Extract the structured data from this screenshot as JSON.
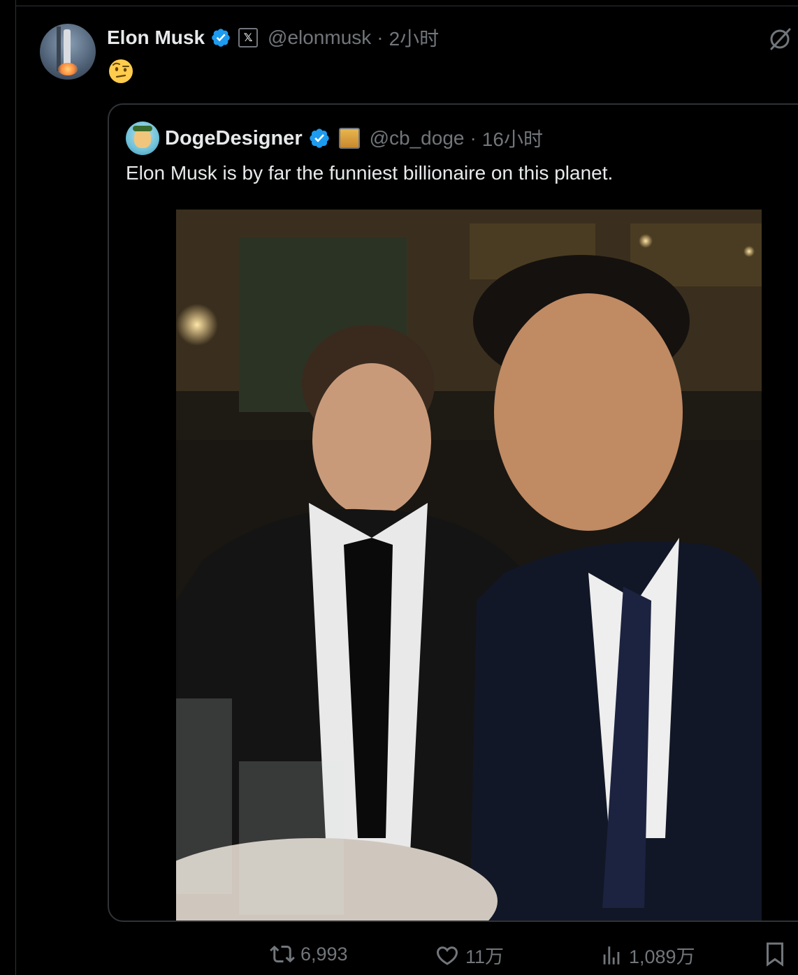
{
  "post": {
    "author": {
      "name": "Elon Musk",
      "handle": "@elonmusk",
      "time": "2小时",
      "separator": "·",
      "avatar_icon": "rocket-launch-avatar",
      "verified_color": "#1d9bf0"
    },
    "text_emoji": "🤨",
    "quote": {
      "author": {
        "name": "DogeDesigner",
        "handle": "@cb_doge",
        "time": "16小时",
        "separator": "·",
        "avatar_icon": "doge-avatar"
      },
      "text": "Elon Musk is by far the funniest billionaire on this planet.",
      "media_icon": "photo-two-men-selfie-dinner"
    },
    "actions": {
      "retweets": "6,993",
      "likes": "11万",
      "views": "1,089万"
    }
  },
  "colors": {
    "background": "#000000",
    "text_primary": "#e7e9ea",
    "text_secondary": "#71767b",
    "border": "#2f3336",
    "accent": "#1d9bf0"
  }
}
